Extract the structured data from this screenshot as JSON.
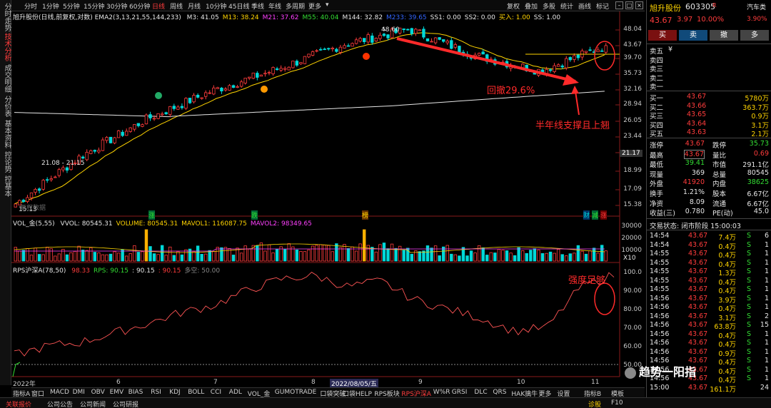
{
  "left_tabs": [
    "分时走势",
    "技术分析",
    "成交明细",
    "分价表",
    "基本资料",
    "控论势",
    "控基本"
  ],
  "toolbar": {
    "periods": [
      "分时",
      "1分钟",
      "5分钟",
      "15分钟",
      "30分钟",
      "60分钟",
      "日线",
      "周线",
      "月线",
      "10分钟",
      "45日线",
      "季线",
      "年线",
      "多周期",
      "更多"
    ],
    "active_period": "日线",
    "right_items": [
      "复权",
      "叠加",
      "多股",
      "统计",
      "画线",
      "标记"
    ]
  },
  "legends": {
    "main": {
      "title": "旭升股份(日线,前复权,对数)",
      "ema_label": "EMA2(3,13,21,55,144,233)",
      "items": [
        {
          "text": "M3: 41.05",
          "color": "#e6e6e6"
        },
        {
          "text": "M13: 38.24",
          "color": "#ffd400"
        },
        {
          "text": "M21: 37.62",
          "color": "#ff40ff"
        },
        {
          "text": "M55: 40.04",
          "color": "#33dd33"
        },
        {
          "text": "M144: 32.82",
          "color": "#e6e6e6"
        },
        {
          "text": "M233: 39.65",
          "color": "#3366ff"
        },
        {
          "text": "SS1: 0.00",
          "color": "#e6e6e6"
        },
        {
          "text": "SS2: 0.00",
          "color": "#e6e6e6"
        },
        {
          "text": "买入: 1.00",
          "color": "#ffd400"
        },
        {
          "text": "SS: 1.00",
          "color": "#e6e6e6"
        }
      ]
    },
    "vol": {
      "title": "VOL_金(5,55)",
      "items": [
        {
          "text": "VVOL: 80545.31",
          "color": "#e6e6e6"
        },
        {
          "text": "VOLUME: 80545.31",
          "color": "#ffd400"
        },
        {
          "text": "MAVOL1: 116087.75",
          "color": "#ffd400"
        },
        {
          "text": "MAVOL2: 98349.65",
          "color": "#ff40ff"
        }
      ]
    },
    "rps": {
      "title": "RPS沪深A(78,50)",
      "items": [
        {
          "text": "98.33",
          "color": "#ff3c3c"
        },
        {
          "text": "RPS: 90.15",
          "color": "#33dd33"
        },
        {
          "text": ": 90.15",
          "color": "#e6e6e6"
        },
        {
          "text": ": 90.15",
          "color": "#ff3c3c"
        },
        {
          "text": "多空: 50.00",
          "color": "#888888"
        }
      ]
    }
  },
  "chart_labels": {
    "high_price": "48.60",
    "low_price": "15.13",
    "range_label": "21.08 - 21.15",
    "price_marker": "21.17",
    "data_notice": "复权数据",
    "event_marks": [
      "涨",
      "跌",
      "榜",
      "财",
      "减",
      "涨"
    ],
    "x_ticks": [
      "2022年",
      "6",
      "7",
      "8",
      "9",
      "10",
      "11"
    ],
    "cursor_date": "2022/08/05/五",
    "vol_unit": "X10"
  },
  "axes": {
    "price": [
      "48.04",
      "43.67",
      "39.70",
      "35.73",
      "32.16",
      "28.94",
      "26.05",
      "23.44",
      "21.17",
      "18.99",
      "17.09",
      "15.38"
    ],
    "vol": [
      "30000",
      "20000",
      "10000"
    ],
    "rps": [
      "100.0",
      "90.00",
      "80.00",
      "70.00",
      "60.00",
      "50.00"
    ]
  },
  "annotations": {
    "pullback": "回撤29.6%",
    "support": "半年线支撑且上翘",
    "strength": "强度足够"
  },
  "indicator_tabs": [
    "指标A",
    "窗口",
    "MACD",
    "DMI",
    "OBV",
    "EMV",
    "BIAS",
    "RSI",
    "KDJ",
    "BOLL",
    "CCI",
    "ADL",
    "VOL_金",
    "GUMOTRADE",
    "口袋突破",
    "口袋HELP",
    "RPS板块",
    "RPS沪深A",
    "W%R",
    "GRSI",
    "DLC",
    "QRS",
    "HAK擒牛",
    "更多",
    "设置"
  ],
  "active_indicator": "RPS沪深A",
  "indicator_right": [
    "指标B",
    "模板"
  ],
  "status_bar": [
    "关联报价",
    "公司公告",
    "公司新闻",
    "公司研报"
  ],
  "status_right": [
    "诊股",
    "F10"
  ],
  "quote": {
    "name": "旭升股份",
    "code": "603305",
    "badge": "R",
    "sector": "汽车类",
    "sector_change": "3.90%",
    "price": "43.67",
    "change": "3.97",
    "pct": "10.00%",
    "buttons": [
      "买",
      "卖",
      "撤",
      "多"
    ],
    "sell_levels": [
      "卖五",
      "卖四",
      "卖三",
      "卖二",
      "卖一"
    ],
    "sell_five_mark": "¥",
    "buy_levels": [
      {
        "label": "买一",
        "price": "43.67",
        "vol": "5780万"
      },
      {
        "label": "买二",
        "price": "43.66",
        "vol": "363.7万"
      },
      {
        "label": "买三",
        "price": "43.65",
        "vol": "0.9万"
      },
      {
        "label": "买四",
        "price": "43.64",
        "vol": "3.1万"
      },
      {
        "label": "买五",
        "price": "43.63",
        "vol": "2.1万"
      }
    ],
    "stats": [
      {
        "l1": "涨停",
        "v1": "43.67",
        "c1": "red",
        "l2": "跌停",
        "v2": "35.73",
        "c2": "green"
      },
      {
        "l1": "最高",
        "v1": "43.67",
        "c1": "red",
        "l2": "量比",
        "v2": "0.69",
        "c2": "red"
      },
      {
        "l1": "最低",
        "v1": "39.41",
        "c1": "green",
        "l2": "市值",
        "v2": "291.1亿",
        "c2": "white"
      },
      {
        "l1": "现量",
        "v1": "369",
        "c1": "white",
        "l2": "总量",
        "v2": "80545",
        "c2": "white"
      },
      {
        "l1": "外盘",
        "v1": "41920",
        "c1": "red",
        "l2": "内盘",
        "v2": "38625",
        "c2": "green"
      },
      {
        "l1": "换手",
        "v1": "1.21%",
        "c1": "white",
        "l2": "股本",
        "v2": "6.67亿",
        "c2": "white"
      },
      {
        "l1": "净资",
        "v1": "8.09",
        "c1": "white",
        "l2": "流通",
        "v2": "6.67亿",
        "c2": "white"
      },
      {
        "l1": "收益(三)",
        "v1": "0.780",
        "c1": "white",
        "l2": "PE(动)",
        "v2": "45.0",
        "c2": "white"
      }
    ],
    "trade_status": "交易状态: 闭市阶段 15:00:03",
    "ticks": [
      {
        "t": "14:54",
        "p": "43.67",
        "v": "7.4万",
        "s": "S",
        "n": "6"
      },
      {
        "t": "14:54",
        "p": "43.67",
        "v": "0.4万",
        "s": "S",
        "n": "1"
      },
      {
        "t": "14:55",
        "p": "43.67",
        "v": "0.4万",
        "s": "S",
        "n": "1"
      },
      {
        "t": "14:55",
        "p": "43.67",
        "v": "0.4万",
        "s": "S",
        "n": "1"
      },
      {
        "t": "14:55",
        "p": "43.67",
        "v": "1.3万",
        "s": "S",
        "n": "1"
      },
      {
        "t": "14:55",
        "p": "43.67",
        "v": "0.4万",
        "s": "S",
        "n": "1"
      },
      {
        "t": "14:55",
        "p": "43.67",
        "v": "0.4万",
        "s": "S",
        "n": "1"
      },
      {
        "t": "14:56",
        "p": "43.67",
        "v": "3.9万",
        "s": "S",
        "n": "1"
      },
      {
        "t": "14:56",
        "p": "43.67",
        "v": "0.4万",
        "s": "S",
        "n": "1"
      },
      {
        "t": "14:56",
        "p": "43.67",
        "v": "3.1万",
        "s": "S",
        "n": "2"
      },
      {
        "t": "14:56",
        "p": "43.67",
        "v": "63.8万",
        "s": "S",
        "n": "15"
      },
      {
        "t": "14:56",
        "p": "43.67",
        "v": "0.4万",
        "s": "S",
        "n": "1"
      },
      {
        "t": "14:56",
        "p": "43.67",
        "v": "0.4万",
        "s": "S",
        "n": "1"
      },
      {
        "t": "14:56",
        "p": "43.67",
        "v": "0.9万",
        "s": "S",
        "n": "1"
      },
      {
        "t": "14:56",
        "p": "43.67",
        "v": "0.4万",
        "s": "S",
        "n": "1"
      },
      {
        "t": "14:56",
        "p": "43.67",
        "v": "0.4万",
        "s": "S",
        "n": "1"
      },
      {
        "t": "14:56",
        "p": "43.67",
        "v": "0.4万",
        "s": "S",
        "n": "1"
      },
      {
        "t": "15:00",
        "p": "43.67",
        "v": "161.1万",
        "s": "",
        "n": "24"
      }
    ]
  },
  "watermark": "趋势一阳指",
  "colors": {
    "up": "#ff3c3c",
    "down": "#00d8d8",
    "bg": "#000000",
    "accent": "#ff3c3c"
  },
  "chart_data": {
    "type": "candlestick",
    "title": "旭升股份(日线,前复权,对数)",
    "price_axis_range": [
      15.13,
      48.6
    ],
    "candles_sampled": [
      {
        "x": "2022-04",
        "close": 15.5
      },
      {
        "x": "2022-05",
        "close": 21.2
      },
      {
        "x": "2022-06",
        "close": 27.0
      },
      {
        "x": "2022-07",
        "close": 32.5
      },
      {
        "x": "2022-07-mid",
        "close": 37.5
      },
      {
        "x": "2022-08",
        "close": 44.0
      },
      {
        "x": "2022-08-05",
        "close": 48.6
      },
      {
        "x": "2022-09",
        "close": 41.0
      },
      {
        "x": "2022-10",
        "close": 37.0
      },
      {
        "x": "2022-11",
        "close": 43.67
      }
    ],
    "rps_series": {
      "name": "RPS沪深A",
      "values": [
        55,
        60,
        62,
        67,
        72,
        78,
        82,
        90,
        96,
        98,
        92,
        95,
        85,
        80,
        75,
        68,
        70,
        92,
        98.33
      ]
    },
    "rps_range": [
      50,
      100
    ]
  }
}
